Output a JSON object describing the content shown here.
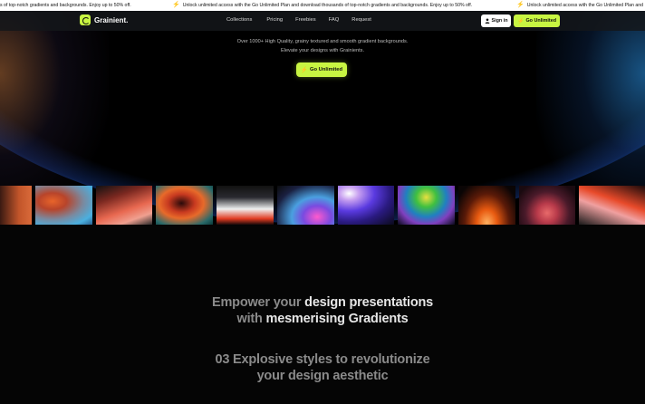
{
  "ticker": {
    "segments": [
      "s of top-notch gradients and backgrounds. Enjoy up to 50% off.",
      "Unlock unlimited access with the Go Unlimited Plan and download thousands of top-notch gradients and backgrounds. Enjoy up to 50% off.",
      "Unlock unlimited access with the Go Unlimited Plan and"
    ]
  },
  "brand": {
    "name": "Grainient.",
    "accent": "#c8f542"
  },
  "nav": {
    "links": [
      "Collections",
      "Pricing",
      "Freebies",
      "FAQ",
      "Request"
    ],
    "signin_label": "Sign in",
    "unlimited_label": "Go Unlimited"
  },
  "hero": {
    "line1": "Over 1000+ High Quality, grainy textured and smooth gradient backgrounds.",
    "line2": "Elevate your designs with Grainients.",
    "cta_label": "Go Unlimited"
  },
  "thumbnails": [
    {
      "name": "gradient-thumb-1",
      "bg": "linear-gradient(90deg,#3a1a12,#c2552a 60%,#d96a3a)"
    },
    {
      "name": "gradient-thumb-2",
      "bg": "radial-gradient(ellipse at 30% 40%,#e8642a 0%,#b8442a 25%,#7a8aa0 55%,#4ab0e0 80%,#2a6090 100%)"
    },
    {
      "name": "gradient-thumb-3",
      "bg": "linear-gradient(160deg,#111 0%,#7a2820 30%,#e86850 60%,#f0a090 80%,#2a2a2a 100%)"
    },
    {
      "name": "gradient-thumb-4",
      "bg": "radial-gradient(ellipse at 45% 45%,#2a0a0a 0%,#c83a20 30%,#e86a2a 50%,#2a6a6a 80%,#0a3a3a 100%)"
    },
    {
      "name": "gradient-thumb-5",
      "bg": "linear-gradient(180deg,#111 0%,#2a2a30 30%,#f0f0f0 60%,#e03a20 85%,#1a0a0a 100%)"
    },
    {
      "name": "gradient-thumb-6",
      "bg": "radial-gradient(ellipse at 70% 80%,#ff5acd 0%,#7a4ae0 25%,#4aa0e0 45%,#1a2040 75%,#0a0a0a 100%)"
    },
    {
      "name": "gradient-thumb-7",
      "bg": "radial-gradient(ellipse at 20% 20%,#ffffff 0%,#c8a0f0 15%,#5a3ae0 40%,#2a1a80 65%,#0a0a1a 100%)"
    },
    {
      "name": "gradient-thumb-8",
      "bg": "radial-gradient(ellipse at 50% 30%,#e8e040 0%,#40c040 25%,#2080c0 50%,#8040c0 70%,#0a0a1a 100%)"
    },
    {
      "name": "gradient-thumb-9",
      "bg": "radial-gradient(ellipse at 50% 95%,#ffb060 0%,#e85a10 25%,#5a1a08 55%,#0a0505 85%)"
    },
    {
      "name": "gradient-thumb-10",
      "bg": "radial-gradient(ellipse at 50% 70%,#e86a6a 0%,#b83a4a 25%,#4a1a2a 55%,#1a0a10 85%)"
    },
    {
      "name": "gradient-thumb-11",
      "bg": "linear-gradient(200deg,#1a0a0a 0%,#e84a2a 40%,#f0a0a0 60%,#1a1a1a 100%)"
    }
  ],
  "headline1": {
    "dim1": "Empower your ",
    "bright1": "design presentations",
    "dim2": "with ",
    "bright2": "mesmerising Gradients"
  },
  "headline2": {
    "dim1": "03 Explosive styles to revolutionize",
    "dim2": "your design aesthetic"
  }
}
